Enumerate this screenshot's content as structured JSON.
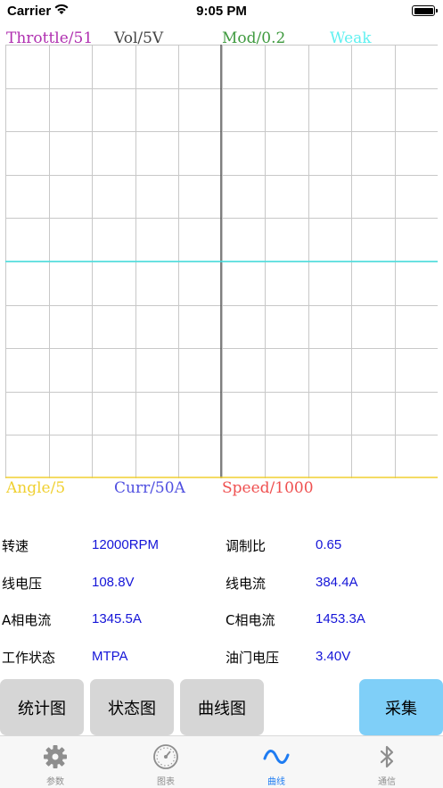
{
  "status_bar": {
    "carrier": "Carrier",
    "time": "9:05 PM"
  },
  "scope": {
    "top_labels": [
      {
        "text": "Throttle/51",
        "color": "#b030b0"
      },
      {
        "text": "Vol/5V",
        "color": "#444444"
      },
      {
        "text": "Mod/0.2",
        "color": "#3f9a3f"
      },
      {
        "text": "Weak",
        "color": "#5ff0f0"
      }
    ],
    "bottom_labels": [
      {
        "text": "Angle/5",
        "color": "#f0d030"
      },
      {
        "text": "Curr/50A",
        "color": "#4f4fe0"
      },
      {
        "text": "Speed/1000",
        "color": "#ef5050"
      }
    ],
    "grid_cols": 10,
    "grid_rows": 10,
    "trace_color": "#40e0e0",
    "axis_color": "#555555",
    "bottom_line_color": "#f0d030"
  },
  "params": [
    {
      "label": "转速",
      "value": "12000RPM"
    },
    {
      "label": "调制比",
      "value": "0.65"
    },
    {
      "label": "线电压",
      "value": "108.8V"
    },
    {
      "label": "线电流",
      "value": "384.4A"
    },
    {
      "label": "A相电流",
      "value": "1345.5A"
    },
    {
      "label": "C相电流",
      "value": "1453.3A"
    },
    {
      "label": "工作状态",
      "value": "MTPA"
    },
    {
      "label": "油门电压",
      "value": "3.40V"
    }
  ],
  "buttons": {
    "stats": "统计图",
    "status": "状态图",
    "curve": "曲线图",
    "collect": "采集"
  },
  "tabs": [
    {
      "label": "参数",
      "icon": "gear-icon"
    },
    {
      "label": "图表",
      "icon": "gauge-icon"
    },
    {
      "label": "曲线",
      "icon": "wave-icon"
    },
    {
      "label": "通信",
      "icon": "bluetooth-icon"
    }
  ],
  "colors": {
    "accent": "#1e7cf2",
    "collect_button": "#7fcff8",
    "value_text": "#1515d8"
  }
}
